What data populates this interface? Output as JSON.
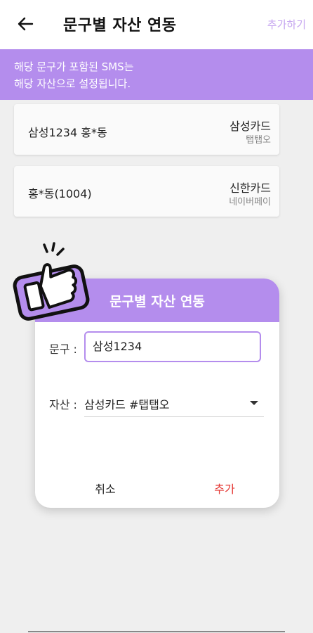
{
  "header": {
    "title": "문구별 자산 연동",
    "add_label": "추가하기"
  },
  "banner": {
    "line1": "해당 문구가 포함된 SMS는",
    "line2": "해당 자산으로 설정됩니다."
  },
  "items": [
    {
      "keyword": "삼성1234 홍*동",
      "asset": "삼성카드",
      "sub": "탭탭오"
    },
    {
      "keyword": "홍*동(1004)",
      "asset": "신한카드",
      "sub": "네이버페이"
    }
  ],
  "dialog": {
    "title": "문구별 자산 연동",
    "keyword_label": "문구 :",
    "keyword_value": "삼성1234",
    "asset_label": "자산 :",
    "asset_value": "삼성카드 #탭탭오",
    "cancel_label": "취소",
    "confirm_label": "추가"
  },
  "colors": {
    "accent": "#b48ded",
    "danger": "#e53935"
  }
}
